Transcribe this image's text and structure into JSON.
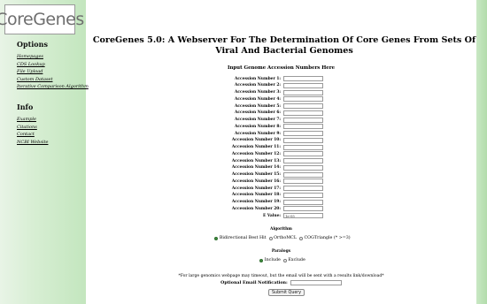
{
  "sidebar": {
    "logo": "CoreGenes",
    "options_heading": "Options",
    "option_links": [
      "Homepages",
      "CDS Lookup",
      "File Upload",
      "Custom Dataset",
      "Iterative Comparison Algorithm"
    ],
    "info_heading": "Info",
    "info_links": [
      "Example",
      "Citations",
      "Contact",
      "NCBI Website"
    ]
  },
  "main": {
    "title": "CoreGenes 5.0: A Webserver For The Determination Of Core Genes From Sets Of Viral And Bacterial Genomes",
    "subheading": "Input Genome Accession Numbers Here",
    "accession_labels": [
      "Accession Number 1:",
      "Accession Number 2:",
      "Accession Number 3:",
      "Accession Number 4:",
      "Accession Number 5:",
      "Accession Number 6:",
      "Accession Number 7:",
      "Accession Number 8:",
      "Accession Number 9:",
      "Accession Number 10:",
      "Accession Number 11:",
      "Accession Number 12:",
      "Accession Number 13:",
      "Accession Number 14:",
      "Accession Number 15:",
      "Accession Number 16:",
      "Accession Number 17:",
      "Accession Number 18:",
      "Accession Number 19:",
      "Accession Number 20:"
    ],
    "evalue_label": "E Value:",
    "evalue_value": "1e-05",
    "algorithm_heading": "Algorithm",
    "algorithm_options": [
      {
        "label": "Bidirectional Best Hit",
        "selected": true
      },
      {
        "label": "OrthoMCL",
        "selected": false
      },
      {
        "label": "COGTriangle (* >=3)",
        "selected": false
      }
    ],
    "paralogs_heading": "Paralogs",
    "paralogs_options": [
      {
        "label": "Include",
        "selected": true
      },
      {
        "label": "Exclude",
        "selected": false
      }
    ],
    "note": "*For large genomics webpage may timeout, but the email will be sent with a results link/download*",
    "email_label": "Optional Email Notification:",
    "submit_label": "Submit Query"
  },
  "colors": {
    "sidebar_bg": "#d7eed3",
    "radio_selected": "#3f8f3f"
  }
}
